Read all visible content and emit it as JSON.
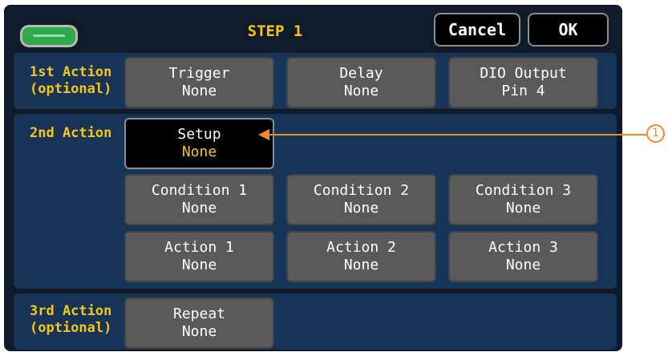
{
  "header": {
    "title": "STEP 1",
    "cancel_label": "Cancel",
    "ok_label": "OK",
    "battery_icon": "battery-icon"
  },
  "sections": [
    {
      "label_line1": "1st Action",
      "label_line2": "(optional)",
      "tiles": [
        {
          "title": "Trigger",
          "value": "None"
        },
        {
          "title": "Delay",
          "value": "None"
        },
        {
          "title": "DIO Output",
          "value": "Pin 4"
        }
      ]
    },
    {
      "label_line1": "2nd Action",
      "label_line2": "",
      "setup": {
        "title": "Setup",
        "value": "None"
      },
      "conditions": [
        {
          "title": "Condition 1",
          "value": "None"
        },
        {
          "title": "Condition 2",
          "value": "None"
        },
        {
          "title": "Condition 3",
          "value": "None"
        }
      ],
      "actions": [
        {
          "title": "Action 1",
          "value": "None"
        },
        {
          "title": "Action 2",
          "value": "None"
        },
        {
          "title": "Action 3",
          "value": "None"
        }
      ]
    },
    {
      "label_line1": "3rd Action",
      "label_line2": "(optional)",
      "tiles": [
        {
          "title": "Repeat",
          "value": "None"
        }
      ]
    }
  ],
  "callout": {
    "number": "1"
  },
  "colors": {
    "accent": "#f5c518",
    "callout": "#ee8a2c",
    "panel": "#173456",
    "background": "#0f1a2b"
  }
}
